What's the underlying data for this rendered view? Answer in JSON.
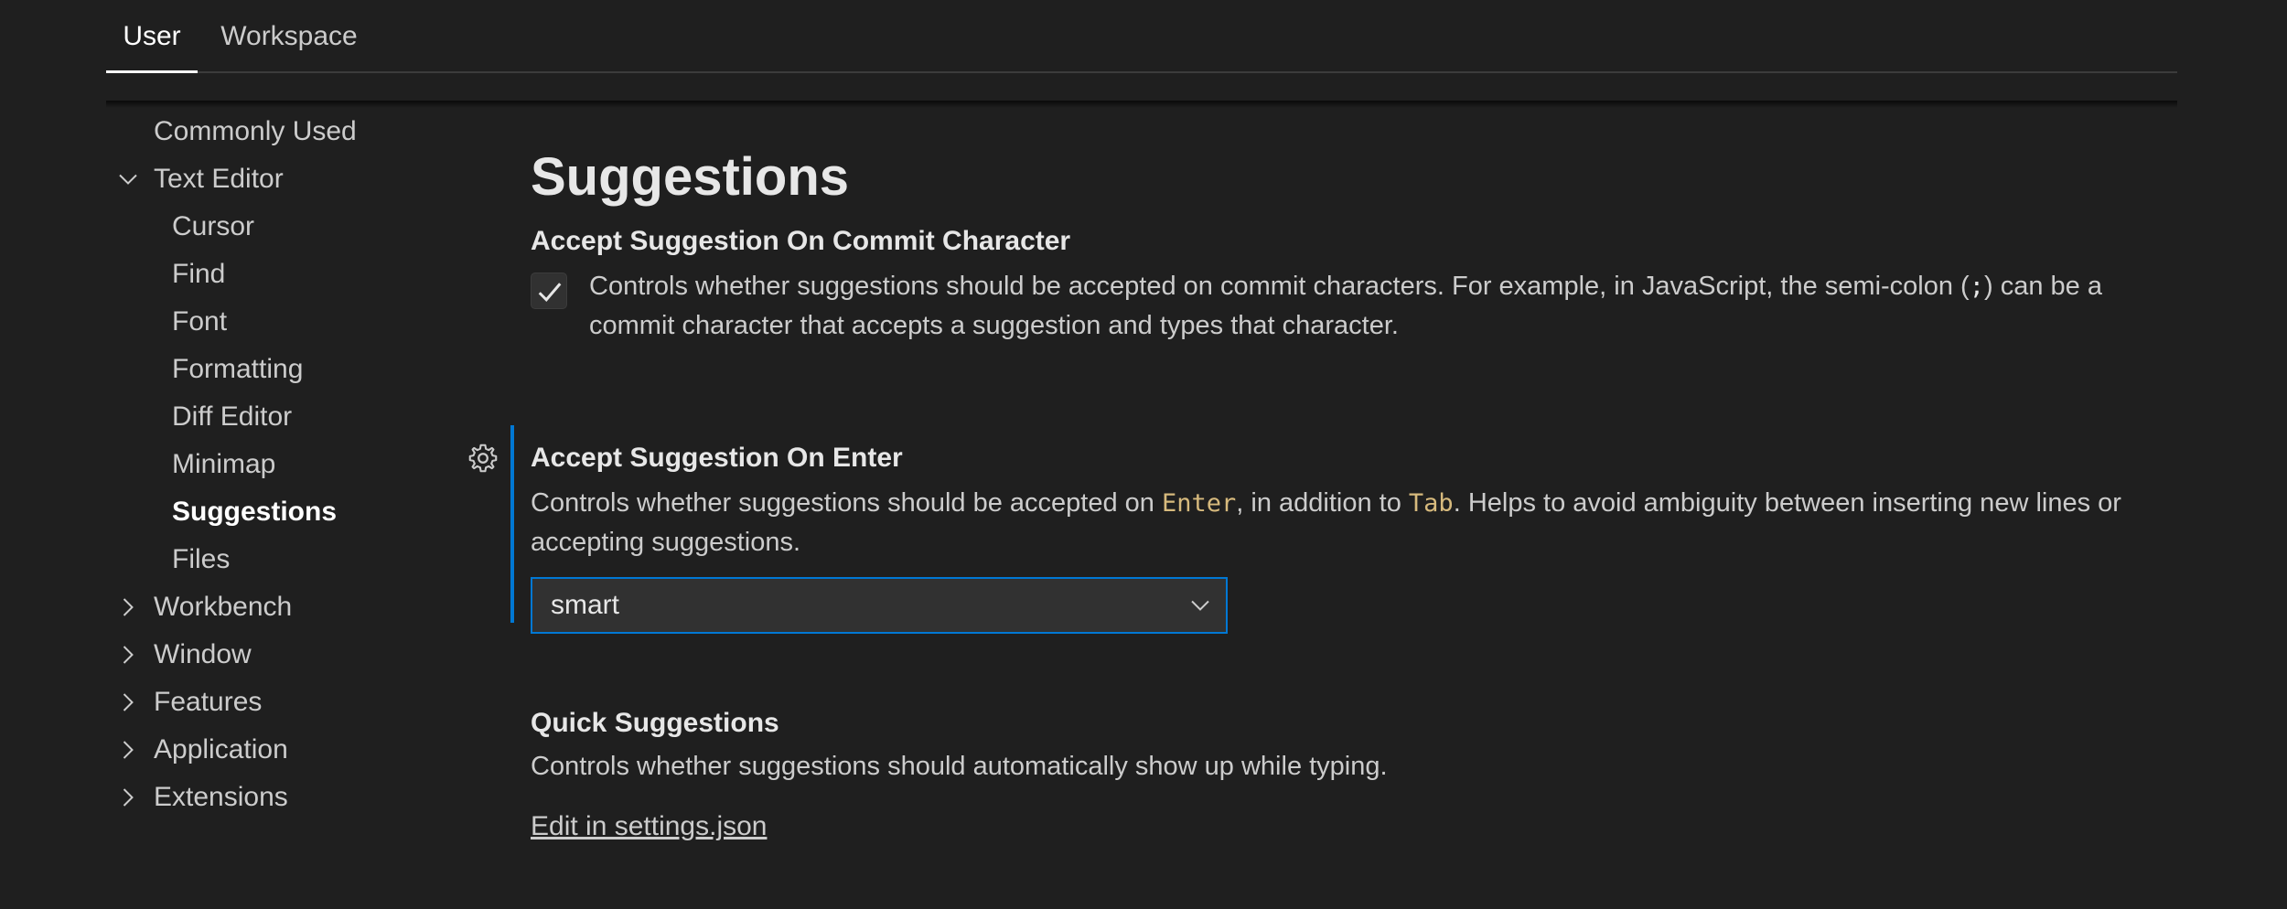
{
  "scope_tabs": {
    "user": "User",
    "workspace": "Workspace"
  },
  "toc": {
    "commonly_used": "Commonly Used",
    "text_editor": "Text Editor",
    "cursor": "Cursor",
    "find": "Find",
    "font": "Font",
    "formatting": "Formatting",
    "diff_editor": "Diff Editor",
    "minimap": "Minimap",
    "suggestions": "Suggestions",
    "files": "Files",
    "workbench": "Workbench",
    "window": "Window",
    "features": "Features",
    "application": "Application",
    "extensions": "Extensions"
  },
  "main": {
    "section_title": "Suggestions",
    "commit_char": {
      "title": "Accept Suggestion On Commit Character",
      "checked": true,
      "desc_before": "Controls whether suggestions should be accepted on commit characters. For example, in JavaScript, the semi-colon (",
      "desc_code": ";",
      "desc_after": ") can be a commit character that accepts a suggestion and types that character."
    },
    "on_enter": {
      "title": "Accept Suggestion On Enter",
      "desc_1": "Controls whether suggestions should be accepted on ",
      "code_enter": "Enter",
      "desc_2": ", in addition to ",
      "code_tab": "Tab",
      "desc_3": ". Helps to avoid ambiguity between inserting new lines or accepting suggestions.",
      "selected_value": "smart"
    },
    "quick": {
      "title": "Quick Suggestions",
      "desc": "Controls whether suggestions should automatically show up while typing.",
      "edit_link": "Edit in settings.json"
    }
  },
  "colors": {
    "background": "#1f1f1f",
    "focus_accent": "#0078d4",
    "code_text": "#d7ba7d"
  },
  "icons": {
    "checkbox": "check-icon",
    "gear": "gear-icon",
    "toc_expanded": "chevron-down-icon",
    "toc_collapsed": "chevron-right-icon",
    "select": "chevron-down-icon"
  }
}
